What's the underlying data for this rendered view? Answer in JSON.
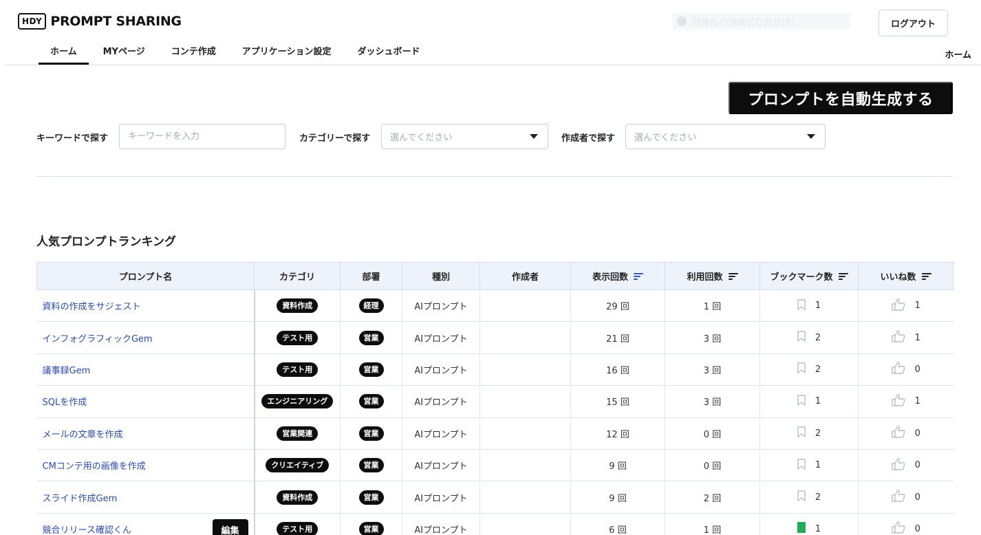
{
  "header": {
    "logo_box": "HDY",
    "logo_text": "PROMPT SHARING",
    "ghost_toggle_label": "四角形の領域切り取り(R)",
    "logout_label": "ログアウト",
    "breadcrumb_right": "ホーム"
  },
  "nav": {
    "tabs": [
      {
        "label": "ホーム",
        "active": true
      },
      {
        "label": "MYページ",
        "active": false
      },
      {
        "label": "コンテ作成",
        "active": false
      },
      {
        "label": "アプリケーション設定",
        "active": false
      },
      {
        "label": "ダッシュボード",
        "active": false
      }
    ]
  },
  "generate_button_label": "プロンプトを自動生成する",
  "filters": {
    "keyword_label": "キーワードで探す",
    "keyword_placeholder": "キーワードを入力",
    "category_label": "カテゴリーで探す",
    "category_value": "選んでください",
    "author_label": "作成者で探す",
    "author_value": "選んでください"
  },
  "ranking": {
    "title": "人気プロンプトランキング",
    "columns": [
      "プロンプト名",
      "カテゴリ",
      "部署",
      "種別",
      "作成者",
      "表示回数",
      "利用回数",
      "ブックマーク数",
      "いいね数"
    ],
    "rows": [
      {
        "name": "資料の作成をサジェスト",
        "category": "資料作成",
        "dept": "経理",
        "type": "AIプロンプト",
        "author": "",
        "views": "29 回",
        "uses": "1 回",
        "bookmarks": "1",
        "bookmarked": false,
        "likes": "1",
        "edit": ""
      },
      {
        "name": "インフォグラフィックGem",
        "category": "テスト用",
        "dept": "営業",
        "type": "AIプロンプト",
        "author": "",
        "views": "21 回",
        "uses": "3 回",
        "bookmarks": "2",
        "bookmarked": false,
        "likes": "1",
        "edit": ""
      },
      {
        "name": "議事録Gem",
        "category": "テスト用",
        "dept": "営業",
        "type": "AIプロンプト",
        "author": "",
        "views": "16 回",
        "uses": "3 回",
        "bookmarks": "2",
        "bookmarked": false,
        "likes": "0",
        "edit": ""
      },
      {
        "name": "SQLを作成",
        "category": "エンジニアリング",
        "dept": "営業",
        "type": "AIプロンプト",
        "author": "",
        "views": "15 回",
        "uses": "3 回",
        "bookmarks": "1",
        "bookmarked": false,
        "likes": "1",
        "edit": ""
      },
      {
        "name": "メールの文章を作成",
        "category": "営業関連",
        "dept": "営業",
        "type": "AIプロンプト",
        "author": "",
        "views": "12 回",
        "uses": "0 回",
        "bookmarks": "2",
        "bookmarked": false,
        "likes": "0",
        "edit": ""
      },
      {
        "name": "CMコンテ用の画像を作成",
        "category": "クリエイティブ",
        "dept": "営業",
        "type": "AIプロンプト",
        "author": "",
        "views": "9 回",
        "uses": "0 回",
        "bookmarks": "1",
        "bookmarked": false,
        "likes": "0",
        "edit": ""
      },
      {
        "name": "スライド作成Gem",
        "category": "資料作成",
        "dept": "営業",
        "type": "AIプロンプト",
        "author": "",
        "views": "9 回",
        "uses": "2 回",
        "bookmarks": "2",
        "bookmarked": false,
        "likes": "0",
        "edit": ""
      },
      {
        "name": "競合リリース確認くん",
        "category": "テスト用",
        "dept": "営業",
        "type": "AIプロンプト",
        "author": "",
        "views": "6 回",
        "uses": "1 回",
        "bookmarks": "1",
        "bookmarked": true,
        "likes": "0",
        "edit": "編集"
      }
    ]
  },
  "colors": {
    "link": "#2a4ca8",
    "header_bg": "#eef3fb",
    "bookmark_active": "#1fad5a",
    "pill_bg": "#0d0d0d"
  }
}
